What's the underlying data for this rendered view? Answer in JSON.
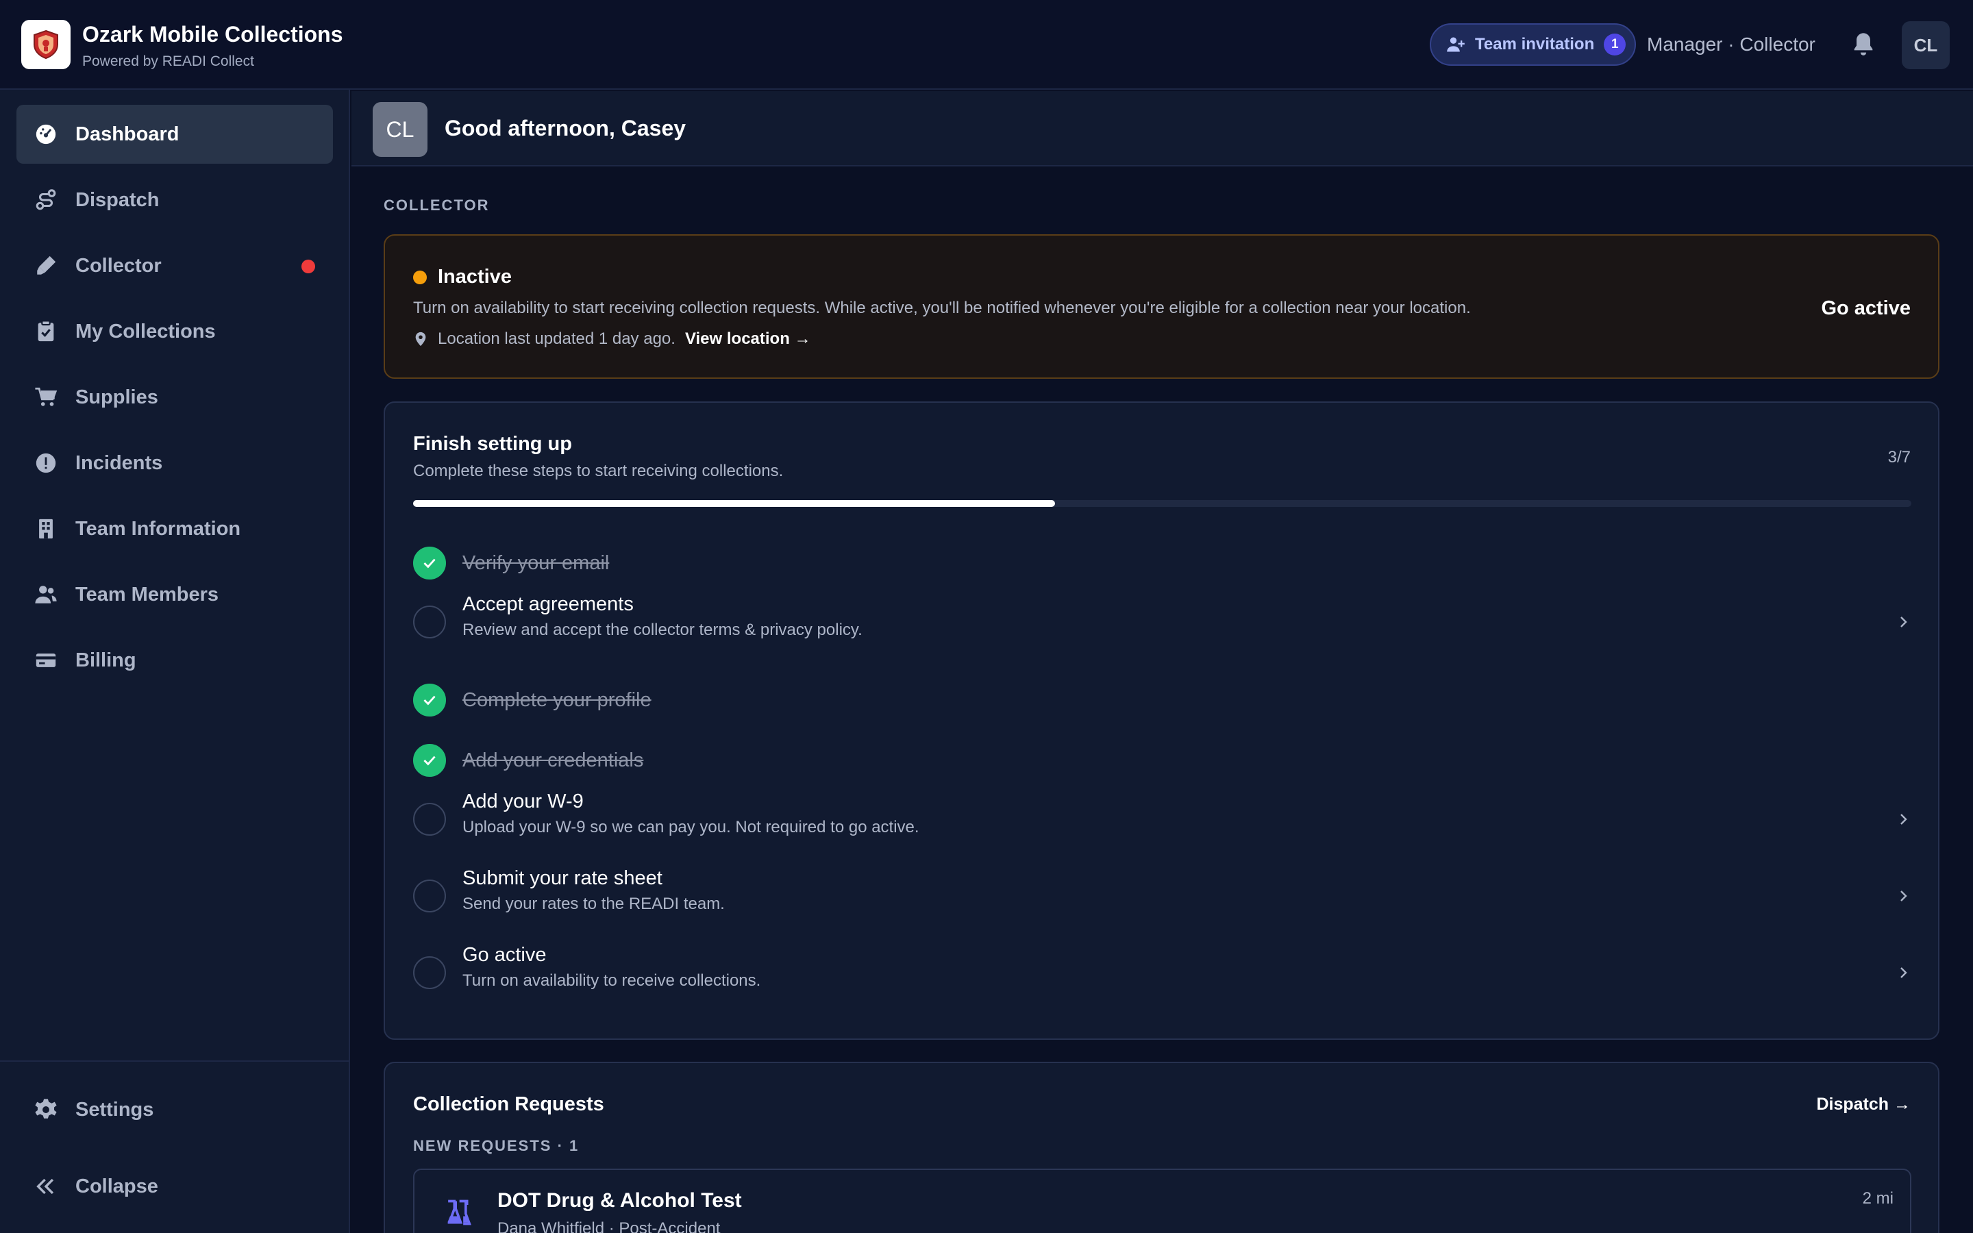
{
  "app": {
    "name": "Ozark Mobile Collections",
    "subtitle": "Powered by READI Collect"
  },
  "header": {
    "invite_label": "Team invitation",
    "invite_count": "1",
    "role": "Manager · Collector",
    "user_initials": "CL"
  },
  "sidebar": {
    "items": [
      {
        "label": "Dashboard",
        "icon": "dashboard-icon",
        "active": true
      },
      {
        "label": "Dispatch",
        "icon": "dispatch-icon"
      },
      {
        "label": "Collector",
        "icon": "collector-icon",
        "alert": true
      },
      {
        "label": "My Collections",
        "icon": "clipboard-icon"
      },
      {
        "label": "Supplies",
        "icon": "cart-icon"
      },
      {
        "label": "Incidents",
        "icon": "alert-icon"
      },
      {
        "label": "Team Information",
        "icon": "building-icon"
      },
      {
        "label": "Team Members",
        "icon": "users-icon"
      },
      {
        "label": "Billing",
        "icon": "card-icon"
      }
    ],
    "footer": [
      {
        "label": "Settings",
        "icon": "gear-icon"
      },
      {
        "label": "Collapse",
        "icon": "chevrons-left-icon"
      }
    ]
  },
  "greeting": {
    "initials": "CL",
    "text": "Good afternoon, Casey"
  },
  "collector_section": {
    "label": "COLLECTOR",
    "status": {
      "title": "Inactive",
      "color": "#f59e0b",
      "description": "Turn on availability to start receiving collection requests. While active, you'll be notified whenever you're eligible for a collection near your location.",
      "location_text": "Location last updated 1 day ago.",
      "location_link": "View location →",
      "action": "Go active"
    }
  },
  "setup": {
    "title": "Finish setting up",
    "subtitle": "Complete these steps to start receiving collections.",
    "count": "3/7",
    "progress": 0.4286,
    "steps": [
      {
        "title": "Verify your email",
        "done": true
      },
      {
        "title": "Accept agreements",
        "desc": "Review and accept the collector terms & privacy policy.",
        "done": false
      },
      {
        "title": "Complete your profile",
        "done": true
      },
      {
        "title": "Add your credentials",
        "done": true
      },
      {
        "title": "Add your W-9",
        "desc": "Upload your W-9 so we can pay you. Not required to go active.",
        "done": false
      },
      {
        "title": "Submit your rate sheet",
        "desc": "Send your rates to the READI team.",
        "done": false
      },
      {
        "title": "Go active",
        "desc": "Turn on availability to receive collections.",
        "done": false
      }
    ]
  },
  "requests": {
    "title": "Collection Requests",
    "link": "Dispatch →",
    "sublabel": "NEW REQUESTS · 1",
    "items": [
      {
        "name": "DOT Drug & Alcohol Test",
        "meta": "Dana Whitfield · Post-Accident",
        "distance": "2 mi",
        "icon": "flask-icon"
      }
    ]
  }
}
